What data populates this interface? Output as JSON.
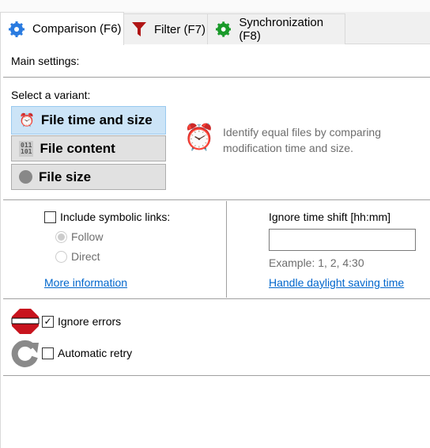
{
  "tabs": [
    {
      "label": "Comparison (F6)",
      "icon": "gear-blue-icon",
      "active": true
    },
    {
      "label": "Filter (F7)",
      "icon": "funnel-red-icon",
      "active": false
    },
    {
      "label": "Synchronization (F8)",
      "icon": "gear-green-icon",
      "active": false
    }
  ],
  "main_settings_label": "Main settings:",
  "variant_label": "Select a variant:",
  "variants": [
    {
      "label": "File time and size",
      "icon": "alarm-clock-icon",
      "selected": true
    },
    {
      "label": "File content",
      "icon": "binary-file-icon",
      "selected": false
    },
    {
      "label": "File size",
      "icon": "file-size-icon",
      "selected": false
    }
  ],
  "variant_description": "Identify equal files by comparing modification time and size.",
  "symlinks": {
    "label": "Include symbolic links:",
    "checked": false,
    "options": [
      {
        "label": "Follow",
        "selected": true
      },
      {
        "label": "Direct",
        "selected": false
      }
    ]
  },
  "more_info_link": "More information",
  "time_shift": {
    "label": "Ignore time shift [hh:mm]",
    "value": "",
    "example": "Example: 1, 2, 4:30",
    "dst_link": "Handle daylight saving time"
  },
  "ignore_errors": {
    "label": "Ignore errors",
    "checked": true
  },
  "auto_retry": {
    "label": "Automatic retry",
    "checked": false
  },
  "colors": {
    "selected_bg": "#cce4f7",
    "link": "#0066cc"
  }
}
